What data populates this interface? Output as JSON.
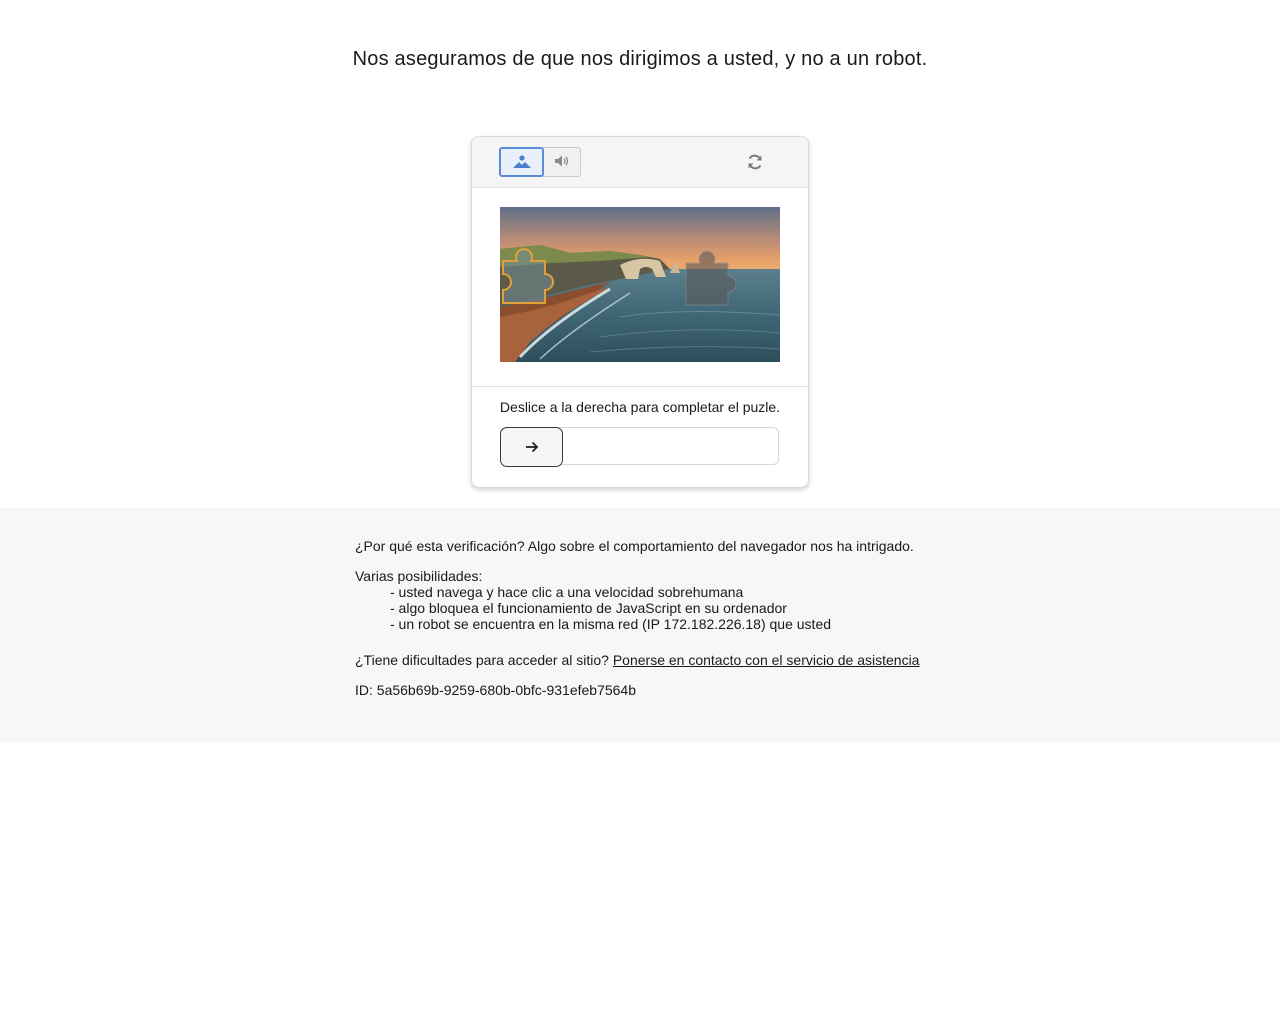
{
  "headline": "Nos aseguramos de que nos dirigimos a usted, y no a un robot.",
  "toolbar": {
    "image_mode_icon": "mountain-image-icon",
    "audio_mode_icon": "speaker-icon",
    "refresh_icon": "refresh-icon",
    "active_mode": "image",
    "accent_color": "#5a8fd8"
  },
  "puzzle": {
    "image_icon": "coastal-cliff-photo",
    "piece_icon": "puzzle-piece-icon",
    "instruction": "Deslice a la derecha para completar el puzle.",
    "slider_icon": "arrow-right-icon",
    "slider_progress": 0
  },
  "info": {
    "why": "¿Por qué esta verificación? Algo sobre el comportamiento del navegador nos ha intrigado.",
    "possibilities_title": "Varias posibilidades:",
    "possibilities": [
      "- usted navega y hace clic a una velocidad sobrehumana",
      "- algo bloquea el funcionamiento de JavaScript en su ordenador",
      "- un robot se encuentra en la misma red (IP 172.182.226.18) que usted"
    ],
    "help_prefix": "¿Tiene dificultades para acceder al sitio? ",
    "help_link": "Ponerse en contacto con el servicio de asistencia",
    "id_line": "ID: 5a56b69b-9259-680b-0bfc-931efeb7564b"
  }
}
